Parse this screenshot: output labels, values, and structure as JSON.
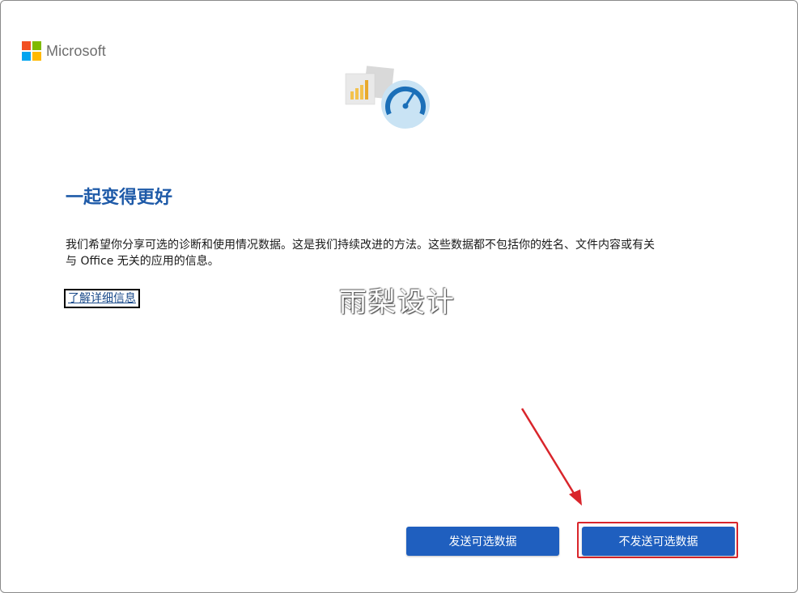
{
  "brand": {
    "name": "Microsoft",
    "colors": [
      "#f25022",
      "#7fba00",
      "#00a4ef",
      "#ffb900"
    ]
  },
  "hero": {
    "icon": "diagnostics-gauge-chart-icon"
  },
  "content": {
    "title": "一起变得更好",
    "body_line1": "我们希望你分享可选的诊断和使用情况数据。这是我们持续改进的方法。这些数据都不包括你的姓名、文件内容或有关",
    "body_line2": "与 Office 无关的应用的信息。",
    "learn_more": "了解详细信息"
  },
  "watermark": "雨梨设计",
  "buttons": {
    "send": "发送可选数据",
    "dont_send": "不发送可选数据"
  },
  "annotation": {
    "color": "#d9252b"
  }
}
